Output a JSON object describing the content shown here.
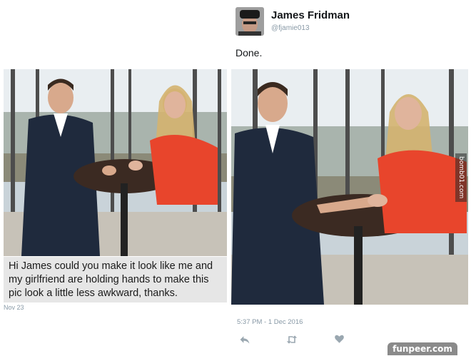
{
  "request": {
    "message": "Hi James could you make it look like me and my girlfriend are holding hands to make this pic look a little less awkward, thanks.",
    "date": "Nov 23"
  },
  "tweet": {
    "display_name": "James Fridman",
    "handle": "@fjamie013",
    "text": "Done.",
    "timestamp": "5:37 PM - 1 Dec 2016"
  },
  "actions": {
    "reply_icon": "reply-icon",
    "retweet_icon": "retweet-icon",
    "like_icon": "heart-icon"
  },
  "watermarks": {
    "corner": "funpeer.com",
    "side": "bomb01.com"
  },
  "colors": {
    "dress": "#e8452c",
    "suit": "#1f2a3d",
    "meta_gray": "#8899a6"
  }
}
